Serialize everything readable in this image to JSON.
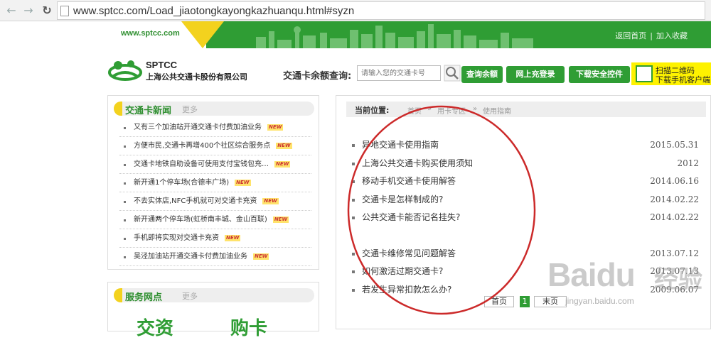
{
  "browser": {
    "url": "www.sptcc.com/Load_jiaotongkayongkazhuanqu.html#syzn"
  },
  "banner": {
    "domain": "www.sptcc.com",
    "links": [
      "返回首页",
      "加入收藏"
    ]
  },
  "header": {
    "logo_en": "SPTCC",
    "logo_cn": "上海公共交通卡股份有限公司",
    "balance_label": "交通卡余额查询:",
    "balance_placeholder": "请输入您的交通卡号",
    "buttons": [
      "查询余额",
      "网上充登录",
      "下载安全控件"
    ],
    "qr_line1": "扫描二维码",
    "qr_line2": "下载手机客户端"
  },
  "news": {
    "title": "交通卡新闻",
    "more": "更多",
    "new_tag": "NEW",
    "items": [
      "又有三个加油站开通交通卡付费加油业务",
      "方便市民,交通卡再增400个社区综合服务点",
      "交通卡地铁自助设备可使用支付宝钱包充…",
      "新开通1个停车场(合德丰广场)",
      "不去实体店,NFC手机就可对交通卡充资",
      "新开通两个停车场(虹桥南丰城、金山百联)",
      "手机即将实现对交通卡充资",
      "吴泾加油站开通交通卡付费加油业务"
    ]
  },
  "service": {
    "title": "服务网点",
    "more": "更多",
    "big1": "交资",
    "big2": "购卡"
  },
  "content": {
    "crumb_label": "当前位置:",
    "crumbs": [
      "首页",
      "»",
      "用卡专区",
      "»",
      "使用指南"
    ],
    "guides": [
      {
        "title": "异地交通卡使用指南",
        "date": "2015.05.31"
      },
      {
        "title": "上海公共交通卡购买使用须知",
        "date": "2012"
      },
      {
        "title": "移动手机交通卡使用解答",
        "date": "2014.06.16"
      },
      {
        "title": "交通卡是怎样制成的?",
        "date": "2014.02.22"
      },
      {
        "title": "公共交通卡能否记名挂失?",
        "date": "2014.02.22"
      },
      {
        "title": "交通卡维修常见问题解答",
        "date": "2013.07.12"
      },
      {
        "title": "如何激活过期交通卡?",
        "date": "2013.07.13"
      },
      {
        "title": "若发生异常扣款怎么办?",
        "date": "2009.06.07"
      }
    ],
    "pager": [
      "首页",
      "1",
      "末页"
    ]
  },
  "watermark": {
    "brand": "Baidu",
    "suffix": "经验",
    "url": "jingyan.baidu.com"
  },
  "colors": {
    "brand_green": "#2f9d34",
    "accent_yellow": "#f3d21e",
    "annotation_red": "#cc2a2a"
  }
}
